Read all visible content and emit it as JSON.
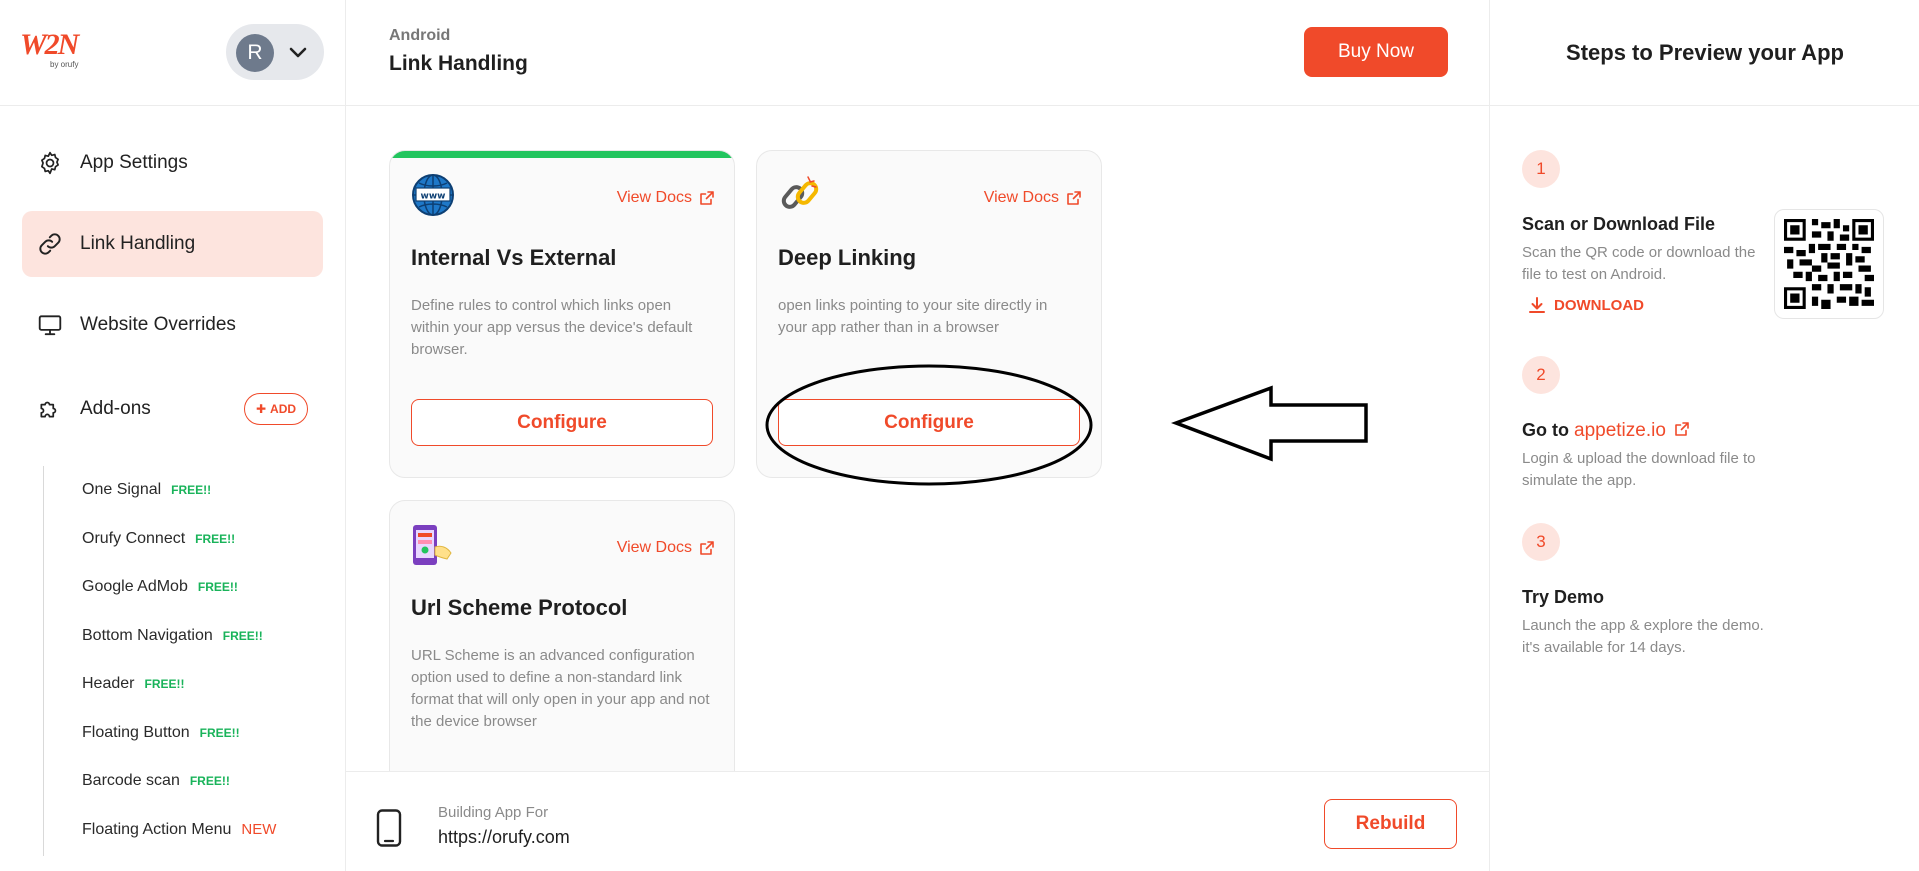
{
  "sidebar": {
    "logo_text": "W2N",
    "logo_sub": "by orufy",
    "user_initial": "R",
    "nav": [
      {
        "label": "App Settings",
        "icon": "gear-icon"
      },
      {
        "label": "Link Handling",
        "icon": "link-icon"
      },
      {
        "label": "Website Overrides",
        "icon": "monitor-icon"
      },
      {
        "label": "Add-ons",
        "icon": "puzzle-icon"
      }
    ],
    "add_label": "ADD",
    "addons": [
      {
        "label": "One Signal",
        "tag": "FREE!!"
      },
      {
        "label": "Orufy Connect",
        "tag": "FREE!!"
      },
      {
        "label": "Google AdMob",
        "tag": "FREE!!"
      },
      {
        "label": "Bottom Navigation",
        "tag": "FREE!!"
      },
      {
        "label": "Header",
        "tag": "FREE!!"
      },
      {
        "label": "Floating Button",
        "tag": "FREE!!"
      },
      {
        "label": "Barcode scan",
        "tag": "FREE!!"
      },
      {
        "label": "Floating Action Menu",
        "tag": "NEW"
      }
    ]
  },
  "header": {
    "platform": "Android",
    "title": "Link Handling",
    "buy_label": "Buy Now"
  },
  "cards": [
    {
      "title": "Internal Vs External",
      "desc": "Define rules to control which links open within your app versus the device's default browser.",
      "docs": "View Docs",
      "button": "Configure",
      "icon": "globe-www-icon"
    },
    {
      "title": "Deep Linking",
      "desc": "open links pointing to your site directly in your app rather than in a browser",
      "docs": "View Docs",
      "button": "Configure",
      "icon": "chain-link-icon"
    },
    {
      "title": "Url Scheme Protocol",
      "desc": "URL Scheme is an advanced configuration option used to define a non-standard link format that will only open in your app and not the device browser",
      "docs": "View Docs",
      "icon": "phone-app-icon"
    }
  ],
  "footer": {
    "label": "Building App For",
    "url": "https://orufy.com",
    "rebuild_label": "Rebuild"
  },
  "preview": {
    "title": "Steps to Preview your App",
    "steps": [
      {
        "num": "1",
        "title": "Scan or Download File",
        "desc": "Scan the QR code or download the file to test on Android.",
        "action": "DOWNLOAD"
      },
      {
        "num": "2",
        "title_prefix": "Go to",
        "link": "appetize.io",
        "desc": "Login & upload the download file to simulate the app."
      },
      {
        "num": "3",
        "title": "Try Demo",
        "desc": "Launch the app & explore the demo. it's available for 14 days."
      }
    ]
  },
  "colors": {
    "accent": "#f04a2a",
    "active_bg": "#fde4de",
    "free_tag": "#19b35a",
    "card_accent": "#22c55e"
  }
}
